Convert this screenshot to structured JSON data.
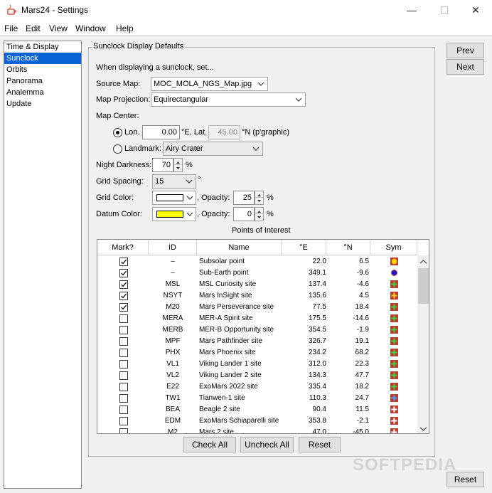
{
  "window": {
    "title": "Mars24 - Settings",
    "minimize_glyph": "—",
    "maximize_glyph": "☐",
    "close_glyph": "✕"
  },
  "menu": [
    "File",
    "Edit",
    "View",
    "Window",
    "Help"
  ],
  "sidebar": {
    "items": [
      "Time & Display",
      "Sunclock",
      "Orbits",
      "Panorama",
      "Analemma",
      "Update"
    ],
    "selected": "Sunclock"
  },
  "nav": {
    "prev": "Prev",
    "next": "Next"
  },
  "panel": {
    "title": "Sunclock Display Defaults",
    "intro": "When displaying a sunclock, set...",
    "source_map_label": "Source Map:",
    "source_map_value": "MOC_MOLA_NGS_Map.jpg",
    "projection_label": "Map Projection:",
    "projection_value": "Equirectangular",
    "map_center_label": "Map Center:",
    "lon_label": "Lon.",
    "lon_value": "0.00",
    "lon_unit": "°E, Lat.",
    "lat_value": "45.00",
    "lat_unit": "°N  (p'graphic)",
    "landmark_label": "Landmark:",
    "landmark_value": "Airy Crater",
    "night_darkness_label": "Night Darkness:",
    "night_darkness_value": "70",
    "percent": "%",
    "grid_spacing_label": "Grid Spacing:",
    "grid_spacing_value": "15",
    "degree": "°",
    "grid_color_label": "Grid Color:",
    "grid_color": "#ffffff",
    "opacity_label": ", Opacity:",
    "grid_opacity_value": "25",
    "datum_color_label": "Datum Color:",
    "datum_color": "#ffff00",
    "datum_opacity_value": "0",
    "poi_title": "Points of Interest"
  },
  "table": {
    "columns": [
      "Mark?",
      "ID",
      "Name",
      "°E",
      "°N",
      "Sym"
    ],
    "rows": [
      {
        "mark": true,
        "id": "–",
        "name": "Subsolar point",
        "e": "22.0",
        "n": "6.5",
        "sym": "sun"
      },
      {
        "mark": true,
        "id": "–",
        "name": "Sub-Earth point",
        "e": "349.1",
        "n": "-9.6",
        "sym": "earth"
      },
      {
        "mark": true,
        "id": "MSL",
        "name": "MSL Curiosity site",
        "e": "137.4",
        "n": "-4.6",
        "sym": "cross-green"
      },
      {
        "mark": true,
        "id": "NSYT",
        "name": "Mars InSight site",
        "e": "135.6",
        "n": "4.5",
        "sym": "cross-yellow"
      },
      {
        "mark": true,
        "id": "M20",
        "name": "Mars Perseverance site",
        "e": "77.5",
        "n": "18.4",
        "sym": "cross-green"
      },
      {
        "mark": false,
        "id": "MERA",
        "name": "MER-A Spirit site",
        "e": "175.5",
        "n": "-14.6",
        "sym": "cross-green"
      },
      {
        "mark": false,
        "id": "MERB",
        "name": "MER-B Opportunity site",
        "e": "354.5",
        "n": "-1.9",
        "sym": "cross-green"
      },
      {
        "mark": false,
        "id": "MPF",
        "name": "Mars Pathfinder site",
        "e": "326.7",
        "n": "19.1",
        "sym": "cross-green"
      },
      {
        "mark": false,
        "id": "PHX",
        "name": "Mars Phoenix site",
        "e": "234.2",
        "n": "68.2",
        "sym": "cross-green"
      },
      {
        "mark": false,
        "id": "VL1",
        "name": "Viking Lander 1 site",
        "e": "312.0",
        "n": "22.3",
        "sym": "cross-green"
      },
      {
        "mark": false,
        "id": "VL2",
        "name": "Viking Lander 2 site",
        "e": "134.3",
        "n": "47.7",
        "sym": "cross-green"
      },
      {
        "mark": false,
        "id": "E22",
        "name": "ExoMars 2022 site",
        "e": "335.4",
        "n": "18.2",
        "sym": "cross-green"
      },
      {
        "mark": false,
        "id": "TW1",
        "name": "Tianwen-1 site",
        "e": "110.3",
        "n": "24.7",
        "sym": "cross-blue"
      },
      {
        "mark": false,
        "id": "BEA",
        "name": "Beagle 2 site",
        "e": "90.4",
        "n": "11.5",
        "sym": "cross-white"
      },
      {
        "mark": false,
        "id": "EDM",
        "name": "ExoMars Schiaparelli site",
        "e": "353.8",
        "n": "-2.1",
        "sym": "cross-white"
      },
      {
        "mark": false,
        "id": "M2",
        "name": "Mars 2 site",
        "e": "47.0",
        "n": "-45.0",
        "sym": "cross-white"
      }
    ]
  },
  "actions": {
    "check_all": "Check All",
    "uncheck_all": "Uncheck All",
    "reset": "Reset"
  },
  "footer": {
    "reset": "Reset"
  },
  "watermark": "SOFTPEDIA",
  "colors": {
    "selection": "#0a64d8",
    "symbol_bg": "#c0392b",
    "sun": "#ffd700",
    "earth": "#1a1acc"
  }
}
